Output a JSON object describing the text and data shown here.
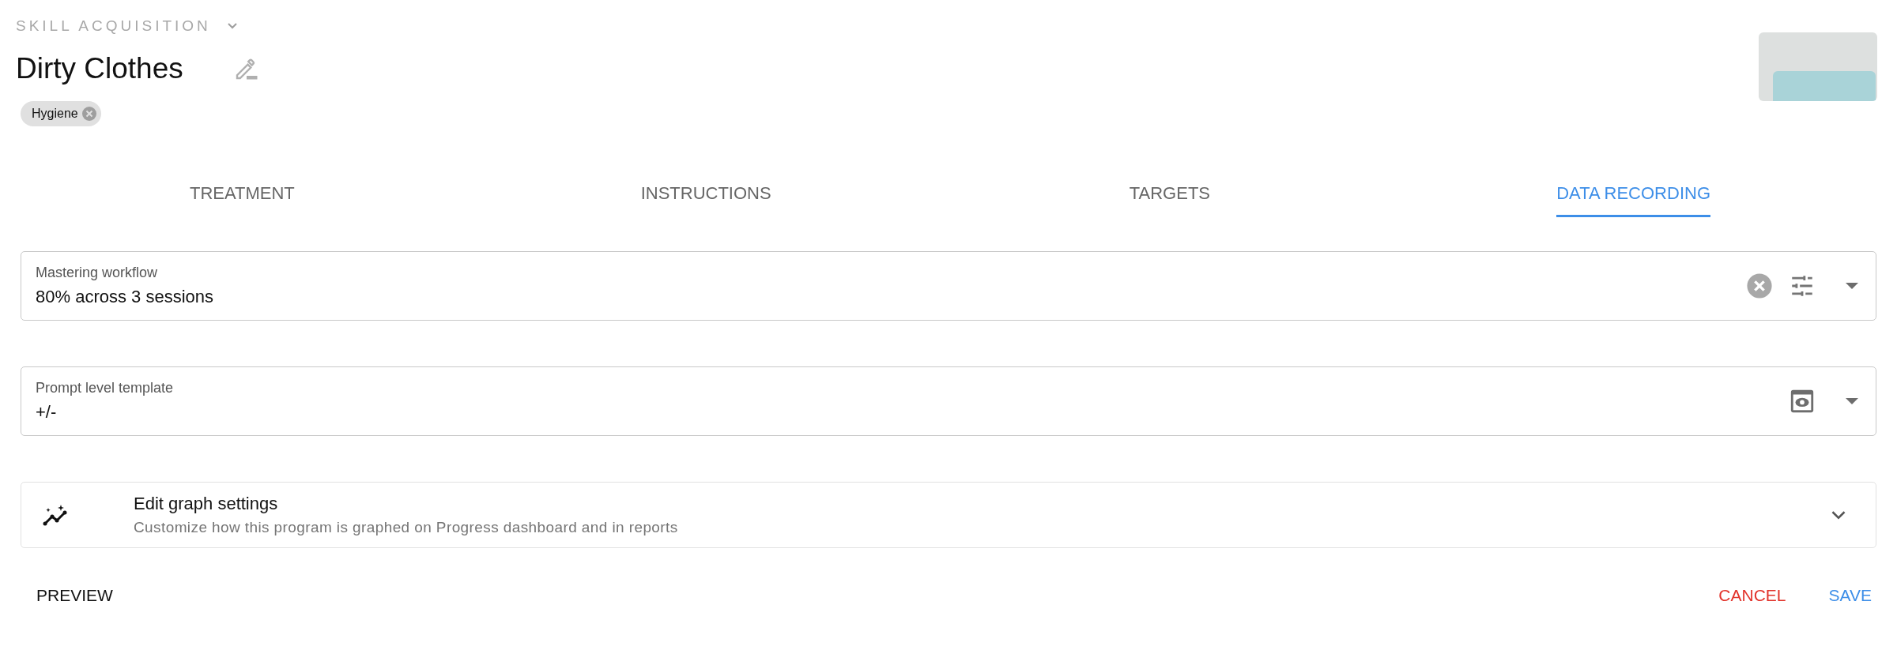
{
  "header": {
    "category": "SKILL ACQUISITION",
    "title": "Dirty Clothes",
    "tags": [
      {
        "label": "Hygiene"
      }
    ]
  },
  "tabs": [
    {
      "label": "TREATMENT",
      "selected": false
    },
    {
      "label": "INSTRUCTIONS",
      "selected": false
    },
    {
      "label": "TARGETS",
      "selected": false
    },
    {
      "label": "DATA RECORDING",
      "selected": true
    }
  ],
  "fields": [
    {
      "kind": "mastering",
      "label": "Mastering workflow",
      "value": "80% across 3 sessions"
    },
    {
      "kind": "prompt",
      "label": "Prompt level template",
      "value": "+/-"
    }
  ],
  "graph_settings": {
    "title": "Edit graph settings",
    "description": "Customize how this program is graphed on Progress dashboard and in reports",
    "expanded": false
  },
  "actions": {
    "preview": "PREVIEW",
    "cancel": "CANCEL",
    "save": "SAVE"
  }
}
